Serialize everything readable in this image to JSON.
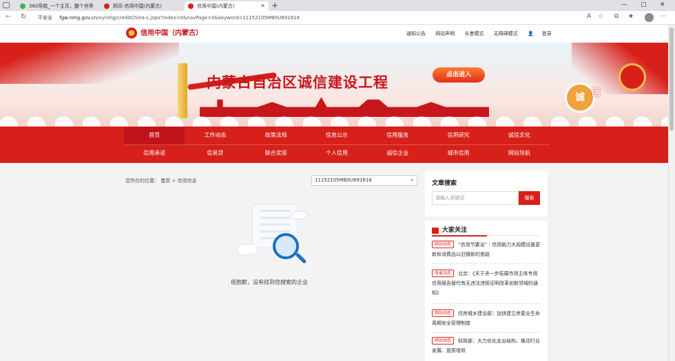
{
  "browser": {
    "tabs": [
      {
        "label": "360导航_一个主页，整个世界",
        "active": false
      },
      {
        "label": "网页-信用中国(内蒙古)",
        "active": false
      },
      {
        "label": "信用中国(内蒙古)",
        "active": true
      }
    ],
    "new_tab": "+",
    "window_controls": [
      "—",
      "▢",
      "✕"
    ],
    "insecure_label": "不安全",
    "url_domain": "fgw.nmg.gov.cn",
    "url_path": "/xynmg/creditChina-L.jspx?index=0&navPage=0&keyword=11152105MB0U891616"
  },
  "site": {
    "logo_text": "信用中国（内蒙古）",
    "top_links": [
      "通知公告",
      "网站声明",
      "长者模式",
      "无障碍模式",
      "登录"
    ],
    "banner_title": "内蒙古自治区诚信建设工程",
    "enter_button": "点击进入",
    "badge_text": "诚",
    "badge_text2": "信"
  },
  "main_nav": {
    "row1": [
      "首页",
      "工作动态",
      "政策法规",
      "信息公示",
      "信用服务",
      "信用研究",
      "诚信文化"
    ],
    "row2": [
      "信用承诺",
      "信易贷",
      "联合奖惩",
      "个人信用",
      "诚信企业",
      "城市信用",
      "网站导航"
    ],
    "selected": "首页"
  },
  "content": {
    "breadcrumb_label": "您所在的位置：",
    "breadcrumb_home": "首页",
    "breadcrumb_sep": ">",
    "breadcrumb_current": "信用信息",
    "search_value": "11152105MB0U891616",
    "empty_text": "很抱歉，没有找到您搜索的企业"
  },
  "sidebar": {
    "search_title": "文章搜索",
    "search_placeholder": "请输入关键词",
    "search_button": "搜索",
    "focus_title": "大家关注",
    "news": [
      {
        "tag": "网站动态",
        "text": "“信用节要谈”｜信用助力大规模设备更新和消费品以旧换新的思路"
      },
      {
        "tag": "各省动态",
        "text": "北京：《关于进一步拓展市场主体专用信用报告替代有无违法违规证明改革创新领域的通知》"
      },
      {
        "tag": "网站动态",
        "text": "住房城乡建设部：加快建立房屋全生命周期安全管理制度"
      },
      {
        "tag": "网站动态",
        "text": "财政部：大力优化支出结构，推动行业发展、提质增效"
      }
    ]
  },
  "colors": {
    "brand_red": "#d8201a",
    "accent_blue": "#1a6fc0"
  }
}
